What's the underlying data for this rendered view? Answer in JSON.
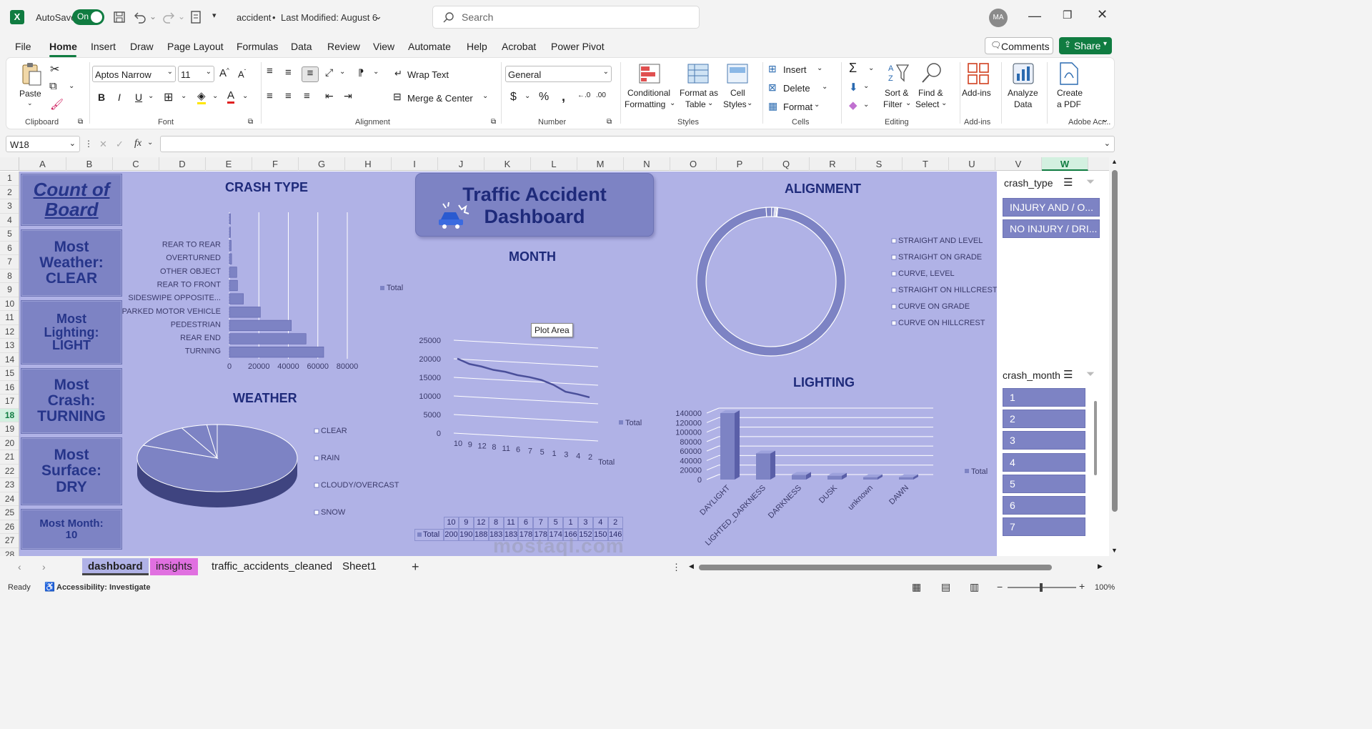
{
  "app": {
    "autosave_label": "AutoSave",
    "autosave_state": "On",
    "doc_title": "accident",
    "doc_modified": "Last Modified: August 6",
    "search_placeholder": "Search",
    "user_initials": "MA"
  },
  "menu": [
    "File",
    "Home",
    "Insert",
    "Draw",
    "Page Layout",
    "Formulas",
    "Data",
    "Review",
    "View",
    "Automate",
    "Help",
    "Acrobat",
    "Power Pivot"
  ],
  "menu_active": "Home",
  "comments_label": "Comments",
  "share_label": "Share",
  "ribbon": {
    "clipboard": {
      "paste": "Paste",
      "group": "Clipboard"
    },
    "font": {
      "name": "Aptos Narrow",
      "size": "11",
      "group": "Font"
    },
    "alignment": {
      "wrap": "Wrap Text",
      "merge": "Merge & Center",
      "group": "Alignment"
    },
    "number": {
      "format": "General",
      "group": "Number"
    },
    "styles": {
      "cond1": "Conditional",
      "cond2": "Formatting",
      "fmt1": "Format as",
      "fmt2": "Table",
      "cell1": "Cell",
      "cell2": "Styles",
      "group": "Styles"
    },
    "cells": {
      "insert": "Insert",
      "delete": "Delete",
      "format": "Format",
      "group": "Cells"
    },
    "editing": {
      "sort1": "Sort &",
      "sort2": "Filter",
      "find1": "Find &",
      "find2": "Select",
      "group": "Editing"
    },
    "addins": {
      "label": "Add-ins",
      "group": "Add-ins"
    },
    "analyze": {
      "l1": "Analyze",
      "l2": "Data"
    },
    "pdf": {
      "l1": "Create",
      "l2": "a PDF",
      "group": "Adobe Acr..."
    }
  },
  "formula": {
    "name_box": "W18",
    "fx": "fx",
    "value": ""
  },
  "columns": [
    "A",
    "B",
    "C",
    "D",
    "E",
    "F",
    "G",
    "H",
    "I",
    "J",
    "K",
    "L",
    "M",
    "N",
    "O",
    "P",
    "Q",
    "R",
    "S",
    "T",
    "U",
    "V",
    "W"
  ],
  "rows": [
    "1",
    "2",
    "3",
    "4",
    "5",
    "6",
    "7",
    "8",
    "9",
    "10",
    "11",
    "12",
    "13",
    "14",
    "15",
    "16",
    "17",
    "18",
    "19",
    "20",
    "21",
    "22",
    "23",
    "24",
    "25",
    "26",
    "27",
    "28"
  ],
  "kpis": [
    {
      "text": "Count of\nBoard"
    },
    {
      "text": "Most\nWeather:\nCLEAR"
    },
    {
      "text": "Most\nLighting:\nLIGHT"
    },
    {
      "text": "Most\nCrash:\nTURNING"
    },
    {
      "text": "Most\nSurface:\nDRY"
    },
    {
      "text": "Most Month:\n10"
    }
  ],
  "dashboard_title": "Traffic Accident\nDashboard",
  "tooltip": "Plot Area",
  "colors": {
    "dash_bg": "#b0b2e6",
    "accent": "#7d83c4",
    "title_text": "#1e2a7a",
    "excel_green": "#107c41"
  },
  "chart_data": [
    {
      "type": "bar",
      "title": "CRASH TYPE",
      "orientation": "horizontal",
      "categories": [
        "REAR TO REAR",
        "OVERTURNED",
        "OTHER OBJECT",
        "REAR TO FRONT",
        "SIDESWIPE OPPOSITE...",
        "PARKED MOTOR VEHICLE",
        "PEDESTRIAN",
        "REAR END",
        "TURNING"
      ],
      "series": [
        {
          "name": "Total",
          "values": [
            300,
            700,
            1200,
            1500,
            5000,
            5500,
            9500,
            21000,
            42000,
            52000,
            64000
          ]
        }
      ],
      "xlim": [
        0,
        80000
      ],
      "xticks": [
        "0",
        "20000",
        "40000",
        "60000",
        "80000"
      ],
      "legend": "right"
    },
    {
      "type": "pie",
      "title": "WEATHER",
      "categories": [
        "CLEAR",
        "RAIN",
        "CLOUDY/OVERCAST",
        "SNOW"
      ],
      "values": [
        78,
        11,
        5,
        2
      ],
      "legend": "right"
    },
    {
      "type": "line",
      "title": "MONTH",
      "categories": [
        "10",
        "9",
        "12",
        "8",
        "11",
        "6",
        "7",
        "5",
        "1",
        "3",
        "4",
        "2"
      ],
      "series": [
        {
          "name": "Total",
          "values": [
            20046,
            19062,
            18844,
            18374,
            18304,
            17875,
            17792,
            17465,
            16627,
            15232,
            15011,
            14627
          ]
        }
      ],
      "ylim": [
        0,
        25000
      ],
      "yticks": [
        "0",
        "5000",
        "10000",
        "15000",
        "20000",
        "25000"
      ],
      "legend": "right"
    },
    {
      "type": "pie",
      "title": "ALIGNMENT",
      "categories": [
        "STRAIGHT AND LEVEL",
        "STRAIGHT ON GRADE",
        "CURVE, LEVEL",
        "STRAIGHT ON HILLCREST",
        "CURVE ON GRADE",
        "CURVE ON HILLCREST"
      ],
      "values": [
        97.5,
        1.2,
        0.6,
        0.3,
        0.25,
        0.15
      ],
      "legend": "right"
    },
    {
      "type": "bar",
      "title": "LIGHTING",
      "categories": [
        "DAYLIGHT",
        "LIGHTED_DARKNESS",
        "DARKNESS",
        "DUSK",
        "unknown",
        "DAWN"
      ],
      "series": [
        {
          "name": "Total",
          "values": [
            140000,
            55000,
            10000,
            8000,
            5000,
            5000
          ]
        }
      ],
      "ylim": [
        0,
        140000
      ],
      "yticks": [
        "0",
        "20000",
        "40000",
        "60000",
        "80000",
        "100000",
        "120000",
        "140000"
      ],
      "legend": "right"
    }
  ],
  "month_table": {
    "header": [
      "10",
      "9",
      "12",
      "8",
      "11",
      "6",
      "7",
      "5",
      "1",
      "3",
      "4",
      "2"
    ],
    "row_label": "Total",
    "values": [
      "200",
      "190",
      "188",
      "183",
      "183",
      "178",
      "178",
      "174",
      "166",
      "152",
      "150",
      "146"
    ]
  },
  "slicers": {
    "crash_type": {
      "title": "crash_type",
      "items": [
        "INJURY AND / O...",
        "NO INJURY / DRI..."
      ]
    },
    "crash_month": {
      "title": "crash_month",
      "items": [
        "1",
        "2",
        "3",
        "4",
        "5",
        "6",
        "7"
      ]
    }
  },
  "sheets": [
    "dashboard",
    "insights",
    "traffic_accidents_cleaned",
    "Sheet1"
  ],
  "active_sheet": "dashboard",
  "status": {
    "ready": "Ready",
    "accessibility": "Accessibility: Investigate",
    "zoom": "100%"
  },
  "watermark": "mostaql.com"
}
